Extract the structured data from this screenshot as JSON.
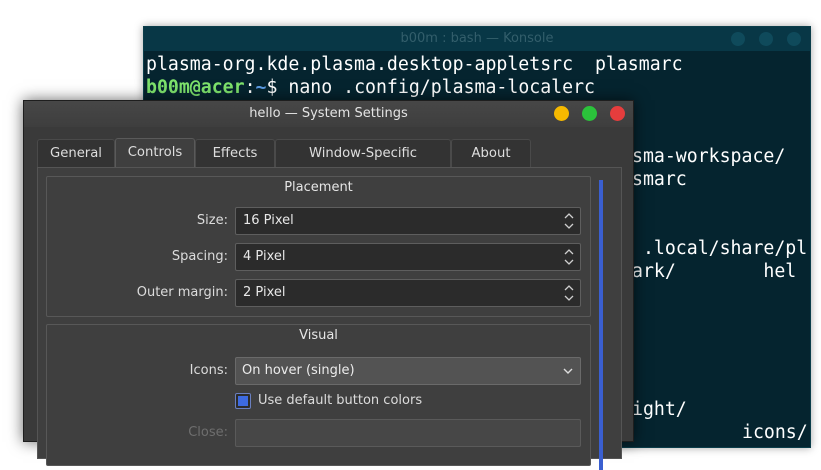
{
  "konsole": {
    "title": "b00m : bash — Konsole",
    "lines": {
      "l1": "plasma-org.kde.plasma.desktop-appletsrc  plasmarc",
      "prompt_user": "b00m@acer",
      "prompt_sep": ":",
      "prompt_path": "~",
      "prompt_cmd": "$ nano .config/plasma-localerc",
      "l3": "sma-workspace/",
      "l4": "smarc",
      "l5": " .local/share/pl",
      "l6": "ark/        hel",
      "l7": "ight/",
      "l8": "icons/"
    }
  },
  "settings": {
    "title": "hello — System Settings",
    "tabs": [
      {
        "label": "General"
      },
      {
        "label": "Controls"
      },
      {
        "label": "Effects"
      },
      {
        "label": "Window-Specific Overrides"
      },
      {
        "label": "About"
      }
    ],
    "placement": {
      "title": "Placement",
      "size_label": "Size:",
      "size_value": "16 Pixel",
      "spacing_label": "Spacing:",
      "spacing_value": "4 Pixel",
      "outer_margin_label": "Outer margin:",
      "outer_margin_value": "2 Pixel"
    },
    "visual": {
      "title": "Visual",
      "icons_label": "Icons:",
      "icons_value": "On hover (single)",
      "default_colors_label": "Use default button colors",
      "close_label": "Close:"
    }
  },
  "colors": {
    "konsole_bg": "#05242f",
    "prompt_user": "#7ee36c",
    "prompt_path": "#5a9ce5",
    "btn_minimize": "#f6b900",
    "btn_maximize": "#2bc23b",
    "btn_close": "#e63d3d",
    "accent": "#3d6ae0"
  }
}
